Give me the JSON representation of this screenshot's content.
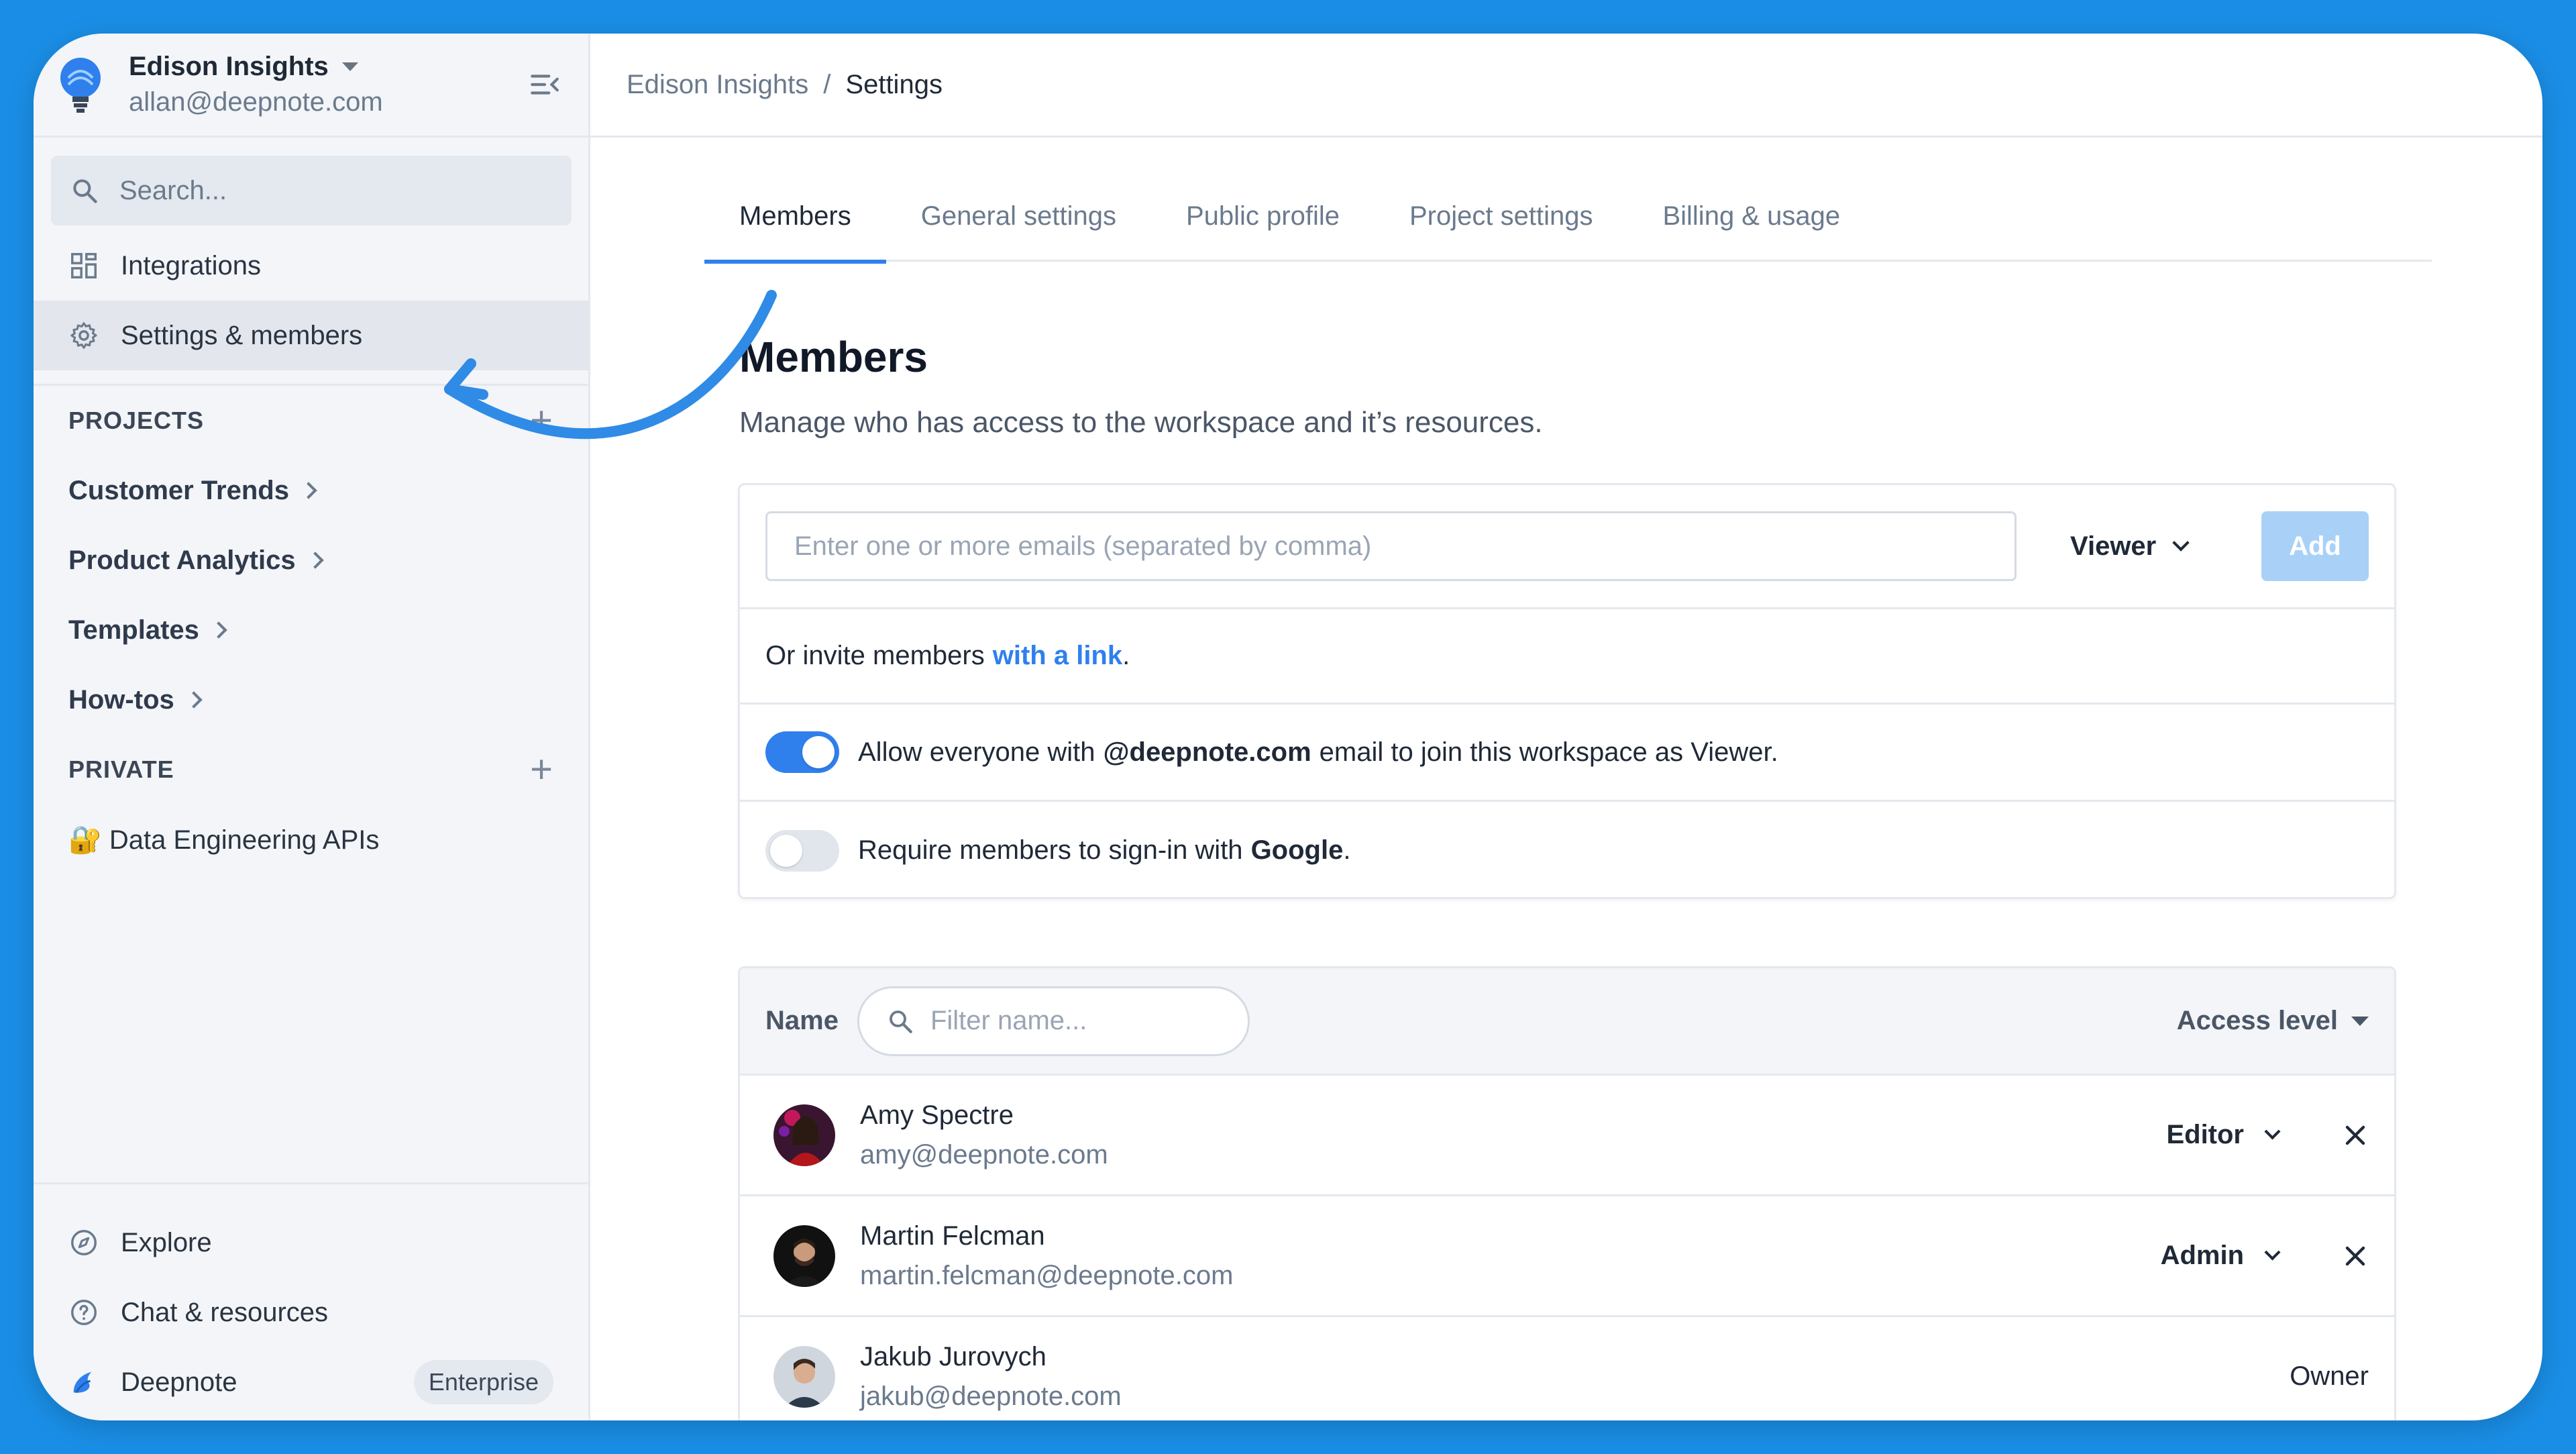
{
  "workspace": {
    "name": "Edison Insights",
    "email": "allan@deepnote.com"
  },
  "sidebar": {
    "search_placeholder": "Search...",
    "nav": [
      {
        "label": "Integrations",
        "icon": "grid-icon"
      },
      {
        "label": "Settings & members",
        "icon": "gear-icon",
        "active": true
      }
    ],
    "projects_header": "PROJECTS",
    "projects": [
      "Customer Trends",
      "Product Analytics",
      "Templates",
      "How-tos"
    ],
    "private_header": "PRIVATE",
    "private_items": [
      "🔐 Data Engineering APIs"
    ],
    "bottom": [
      {
        "label": "Explore",
        "icon": "compass-icon"
      },
      {
        "label": "Chat & resources",
        "icon": "help-circle-icon"
      },
      {
        "label": "Deepnote",
        "icon": "deepnote-logo-icon",
        "badge": "Enterprise"
      }
    ]
  },
  "breadcrumb": {
    "parent": "Edison Insights",
    "separator": "/",
    "current": "Settings"
  },
  "tabs": [
    "Members",
    "General settings",
    "Public profile",
    "Project settings",
    "Billing & usage"
  ],
  "active_tab": "Members",
  "page": {
    "title": "Members",
    "subtitle": "Manage who has access to the workspace and it’s resources."
  },
  "invite": {
    "email_placeholder": "Enter one or more emails (separated by comma)",
    "role": "Viewer",
    "add_label": "Add",
    "link_prefix": "Or invite members",
    "link_text": "with a link",
    "link_suffix": ".",
    "domain_toggle": {
      "on": true,
      "prefix": "Allow everyone with",
      "domain": "@deepnote.com",
      "suffix": "email to join this workspace as Viewer."
    },
    "google_toggle": {
      "on": false,
      "prefix": "Require members to sign-in with",
      "provider": "Google",
      "suffix": "."
    }
  },
  "members_table": {
    "name_header": "Name",
    "filter_placeholder": "Filter name...",
    "access_header": "Access level",
    "rows": [
      {
        "name": "Amy Spectre",
        "email": "amy@deepnote.com",
        "role": "Editor",
        "removable": true
      },
      {
        "name": "Martin Felcman",
        "email": "martin.felcman@deepnote.com",
        "role": "Admin",
        "removable": true
      },
      {
        "name": "Jakub Jurovych",
        "email": "jakub@deepnote.com",
        "role": "Owner",
        "removable": false
      }
    ]
  },
  "colors": {
    "background": "#1a8ee6",
    "accent": "#2f80ed",
    "annotation_arrow": "#2f8be6"
  }
}
